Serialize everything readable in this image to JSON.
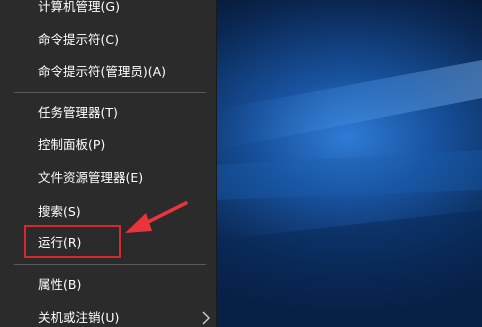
{
  "menu": {
    "items": [
      {
        "label": "计算机管理(G)"
      },
      {
        "label": "命令提示符(C)"
      },
      {
        "label": "命令提示符(管理员)(A)"
      },
      {
        "label": "任务管理器(T)"
      },
      {
        "label": "控制面板(P)"
      },
      {
        "label": "文件资源管理器(E)"
      },
      {
        "label": "搜索(S)"
      },
      {
        "label": "运行(R)"
      },
      {
        "label": "属性(B)"
      },
      {
        "label": "关机或注销(U)"
      }
    ]
  },
  "colors": {
    "menu_background": "#2b2b2b",
    "highlight_box": "#d9272e",
    "annotation_arrow": "#e8343a",
    "desktop": "#0b2a55"
  },
  "icons": {
    "submenu": "chevron-right-icon"
  }
}
